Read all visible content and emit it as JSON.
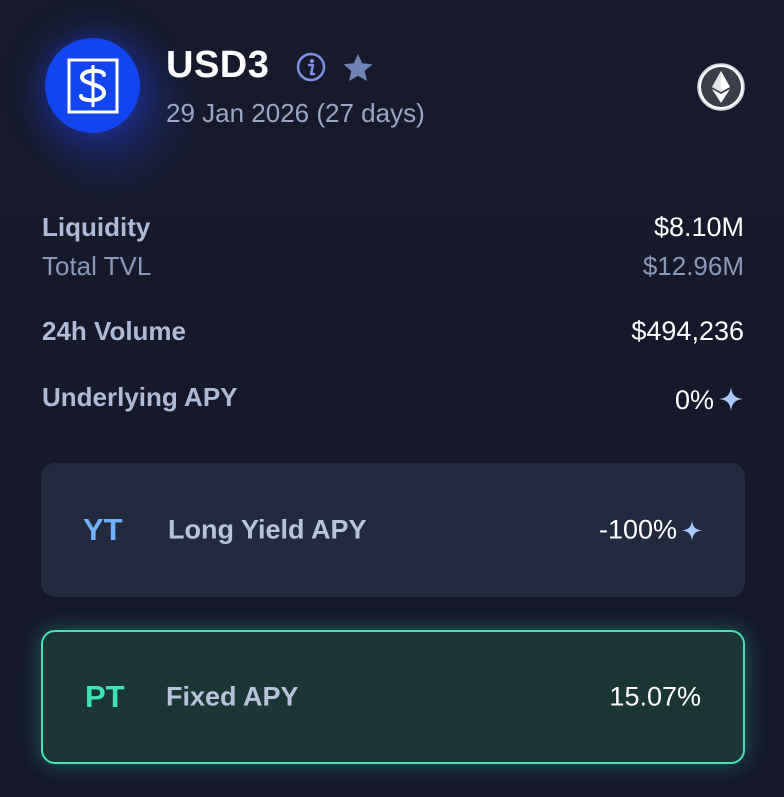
{
  "header": {
    "token_name": "USD3",
    "maturity": "29 Jan 2026 (27 days)",
    "logo_icon": "dollar-logo-icon",
    "chain_icon": "ethereum-icon",
    "accent": "#1244f0"
  },
  "stats": {
    "liquidity_label": "Liquidity",
    "liquidity_value": "$8.10M",
    "tvl_label": "Total TVL",
    "tvl_value": "$12.96M",
    "volume_label": "24h Volume",
    "volume_value": "$494,236",
    "underlying_label": "Underlying APY",
    "underlying_value": "0%"
  },
  "yt": {
    "tag": "YT",
    "label": "Long Yield APY",
    "value": "-100%",
    "color": "#6fb0ff"
  },
  "pt": {
    "tag": "PT",
    "label": "Fixed APY",
    "value": "15.07%",
    "color": "#3ee3b5"
  }
}
